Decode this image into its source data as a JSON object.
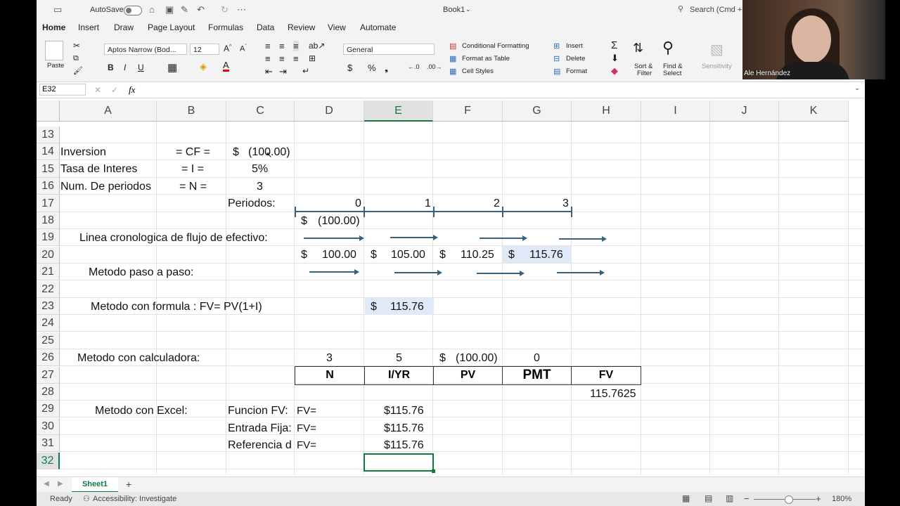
{
  "titlebar": {
    "autosave": "AutoSave",
    "doc_title": "Book1",
    "search": "Search (Cmd +"
  },
  "tabs": [
    "Home",
    "Insert",
    "Draw",
    "Page Layout",
    "Formulas",
    "Data",
    "Review",
    "View",
    "Automate"
  ],
  "ribbon": {
    "paste": "Paste",
    "font_name": "Aptos Narrow (Bod...",
    "font_size": "12",
    "number_format": "General",
    "conditional_formatting": "Conditional Formatting",
    "format_as_table": "Format as Table",
    "cell_styles": "Cell Styles",
    "insert": "Insert",
    "delete": "Delete",
    "format": "Format",
    "sort_filter_1": "Sort &",
    "sort_filter_2": "Filter",
    "find_select_1": "Find &",
    "find_select_2": "Select",
    "sensitivity": "Sensitivity"
  },
  "formula_bar": {
    "name_box": "E32",
    "fx": "fx",
    "content": ""
  },
  "columns": [
    "A",
    "B",
    "C",
    "D",
    "E",
    "F",
    "G",
    "H",
    "I",
    "J",
    "K"
  ],
  "rows": [
    "13",
    "14",
    "15",
    "16",
    "17",
    "18",
    "19",
    "20",
    "21",
    "22",
    "23",
    "24",
    "25",
    "26",
    "27",
    "28",
    "29",
    "30",
    "31",
    "32"
  ],
  "cells": {
    "a14": "Inversion",
    "b14": "= CF =",
    "c14_sign": "$",
    "c14": "(100.00)",
    "a15": "Tasa de Interes",
    "b15": "= I =",
    "c15": "5%",
    "a16": "Num. De periodos",
    "b16": "= N =",
    "c16": "3",
    "c17": "Periodos:",
    "d17": "0",
    "e17": "1",
    "f17": "2",
    "g17": "3",
    "d18_sign": "$",
    "d18": "(100.00)",
    "a19": "Linea cronologica de flujo de efectivo:",
    "d20_sign": "$",
    "d20": "100.00",
    "e20_sign": "$",
    "e20": "105.00",
    "f20_sign": "$",
    "f20": "110.25",
    "g20_sign": "$",
    "g20": "115.76",
    "a21": "Metodo paso a paso:",
    "a23": "Metodo con formula : FV= PV(1+I)",
    "e23_sign": "$",
    "e23": "115.76",
    "a26": "Metodo con calculadora:",
    "d26": "3",
    "e26": "5",
    "f26_sign": "$",
    "f26": "(100.00)",
    "g26": "0",
    "d27": "N",
    "e27": "I/YR",
    "f27": "PV",
    "g27": "PMT",
    "h27": "FV",
    "h28": "115.7625",
    "a29": "Metodo con Excel:",
    "c29": "Funcion FV:",
    "d29": "FV=",
    "e29": "$115.76",
    "c30": "Entrada Fija:",
    "d30": "FV=",
    "e30": "$115.76",
    "c31": "Referencia d",
    "d31": "FV=",
    "e31": "$115.76"
  },
  "sheet_tab": "Sheet1",
  "status": {
    "ready": "Ready",
    "accessibility": "Accessibility: Investigate",
    "zoom": "180%"
  },
  "video": {
    "participant": "Ale Hernández"
  },
  "colors": {
    "excel_green": "#107c41",
    "selection_fill": "#dfe9f7",
    "arrow": "#35607f"
  }
}
